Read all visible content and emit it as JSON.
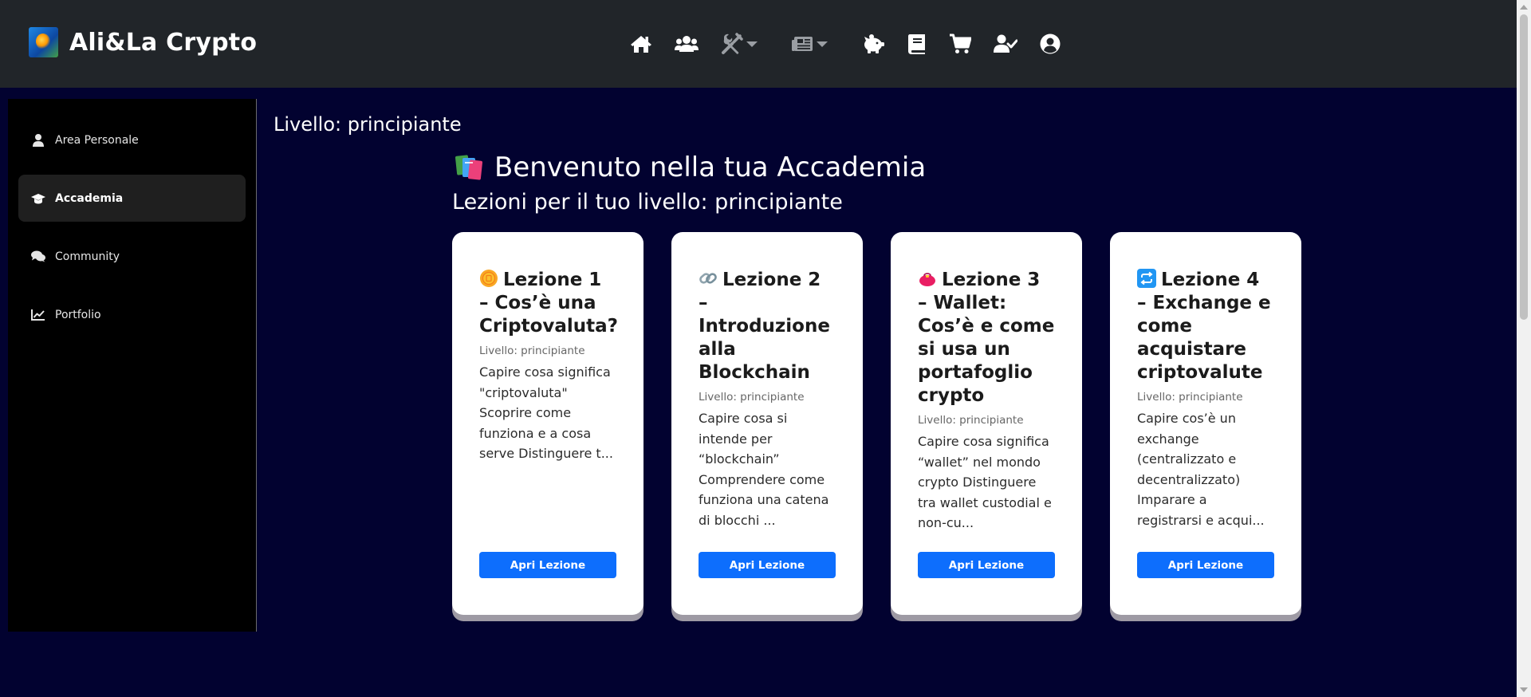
{
  "brand": {
    "name": "Ali&La Crypto"
  },
  "nav": {
    "icons": [
      "home-icon",
      "users-icon",
      "tools-icon",
      "newspaper-icon",
      "piggy-bank-icon",
      "book-icon",
      "cart-icon",
      "user-check-icon",
      "user-circle-icon"
    ]
  },
  "sidebar": {
    "items": [
      {
        "label": "Area Personale",
        "icon": "user-icon",
        "active": false
      },
      {
        "label": "Accademia",
        "icon": "graduation-cap-icon",
        "active": true
      },
      {
        "label": "Community",
        "icon": "comments-icon",
        "active": false
      },
      {
        "label": "Portfolio",
        "icon": "chart-line-icon",
        "active": false
      }
    ]
  },
  "main": {
    "level_label": "Livello: principiante",
    "heading": "Benvenuto nella tua Accademia",
    "subheading": "Lezioni per il tuo livello: principiante"
  },
  "lessons": [
    {
      "emoji": "coin-emoji",
      "title": "Lezione 1 – Cos’è una Criptovaluta?",
      "level": "Livello: principiante",
      "desc": "Capire cosa significa \"criptovaluta\" Scoprire come funziona e a cosa serve Distinguere t...",
      "button": "Apri Lezione"
    },
    {
      "emoji": "link-emoji",
      "title": "Lezione 2 – Introduzione alla Blockchain",
      "level": "Livello: principiante",
      "desc": "Capire cosa si intende per “blockchain” Comprendere come funziona una catena di blocchi ...",
      "button": "Apri Lezione"
    },
    {
      "emoji": "purse-emoji",
      "title": "Lezione 3 – Wallet: Cos’è e come si usa un portafoglio crypto",
      "level": "Livello: principiante",
      "desc": "Capire cosa significa “wallet” nel mondo crypto Distinguere tra wallet custodial e non-cu...",
      "button": "Apri Lezione"
    },
    {
      "emoji": "repeat-emoji",
      "title": "Lezione 4 – Exchange e come acquistare criptovalute",
      "level": "Livello: principiante",
      "desc": "Capire cos’è un exchange (centralizzato e decentralizzato) Imparare a registrarsi e acqui...",
      "button": "Apri Lezione"
    }
  ],
  "colors": {
    "page_bg": "#020230",
    "navbar_bg": "#212529",
    "sidebar_bg": "#000000",
    "button": "#0d6efd"
  }
}
